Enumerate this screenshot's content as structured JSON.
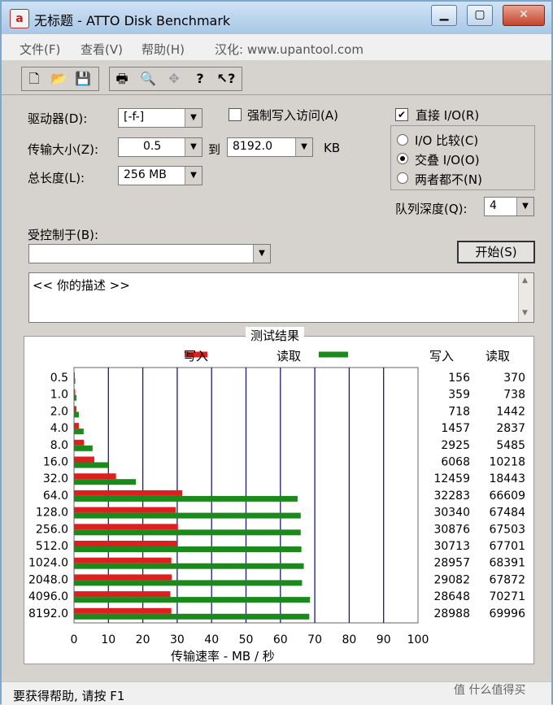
{
  "window": {
    "title": "无标题 - ATTO Disk Benchmark",
    "icon_letter": "a"
  },
  "menu": [
    {
      "label": "文件(F)"
    },
    {
      "label": "查看(V)"
    },
    {
      "label": "帮助(H)"
    },
    {
      "label": "汉化: www.upantool.com"
    }
  ],
  "toolbar": [
    {
      "icon": "new-doc-icon",
      "glyph": "🗋"
    },
    {
      "icon": "open-folder-icon",
      "glyph": "📂"
    },
    {
      "icon": "save-icon",
      "glyph": "💾"
    },
    {
      "icon": "print-icon",
      "glyph": "🖶"
    },
    {
      "icon": "print-preview-icon",
      "glyph": "🔍"
    },
    {
      "icon": "move-icon",
      "glyph": "✥"
    },
    {
      "icon": "help-icon",
      "glyph": "?"
    },
    {
      "icon": "context-help-icon",
      "glyph": "↖?"
    }
  ],
  "settings": {
    "drive_label": "驱动器(D):",
    "drive_value": "[-f-]",
    "transfer_label": "传输大小(Z):",
    "transfer_from": "0.5",
    "to_label": "到",
    "transfer_to": "8192.0",
    "kb_label": "KB",
    "length_label": "总长度(L):",
    "length_value": "256 MB",
    "force_write_label": "强制写入访问(A)",
    "force_write_checked": "",
    "direct_io_label": "直接 I/O(R)",
    "direct_io_checked": "✔",
    "io_compare_label": "I/O 比较(C)",
    "overlapped_io_label": "交叠 I/O(O)",
    "neither_label": "两者都不(N)",
    "queue_label": "队列深度(Q):",
    "queue_value": "4",
    "controlled_by_label": "受控制于(B):",
    "controlled_by_value": "",
    "start_label": "开始(S)",
    "description": "<< 你的描述  >>"
  },
  "results": {
    "title": "测试结果",
    "legend_write": "写入",
    "legend_read": "读取",
    "col_write": "写入",
    "col_read": "读取"
  },
  "colors": {
    "write": "#dd1f1f",
    "read": "#1a8a1a",
    "grid": "#1a1a80"
  },
  "chart_data": {
    "type": "bar",
    "orientation": "horizontal",
    "categories": [
      "0.5",
      "1.0",
      "2.0",
      "4.0",
      "8.0",
      "16.0",
      "32.0",
      "64.0",
      "128.0",
      "256.0",
      "512.0",
      "1024.0",
      "2048.0",
      "4096.0",
      "8192.0"
    ],
    "series": [
      {
        "name": "写入",
        "values": [
          0.15,
          0.35,
          0.7,
          1.4,
          2.9,
          5.9,
          12.2,
          31.5,
          29.6,
          30.2,
          30.0,
          28.3,
          28.4,
          28.0,
          28.3
        ]
      },
      {
        "name": "读取",
        "values": [
          0.36,
          0.72,
          1.41,
          2.8,
          5.4,
          10.0,
          18.0,
          65.0,
          65.9,
          65.9,
          66.1,
          66.8,
          66.3,
          68.6,
          68.4
        ]
      }
    ],
    "table_write": [
      "156",
      "359",
      "718",
      "1457",
      "2925",
      "6068",
      "12459",
      "32283",
      "30340",
      "30876",
      "30713",
      "28957",
      "29082",
      "28648",
      "28988"
    ],
    "table_read": [
      "370",
      "738",
      "1442",
      "2837",
      "5485",
      "10218",
      "18443",
      "66609",
      "67484",
      "67503",
      "67701",
      "68391",
      "67872",
      "70271",
      "69996"
    ],
    "xlabel": "传输速率 - MB / 秒",
    "xlim": [
      0,
      100
    ],
    "xticks": [
      "0",
      "10",
      "20",
      "30",
      "40",
      "50",
      "60",
      "70",
      "80",
      "90",
      "100"
    ]
  },
  "status": {
    "text": "要获得帮助, 请按 F1"
  },
  "watermark": "值 什么值得买"
}
